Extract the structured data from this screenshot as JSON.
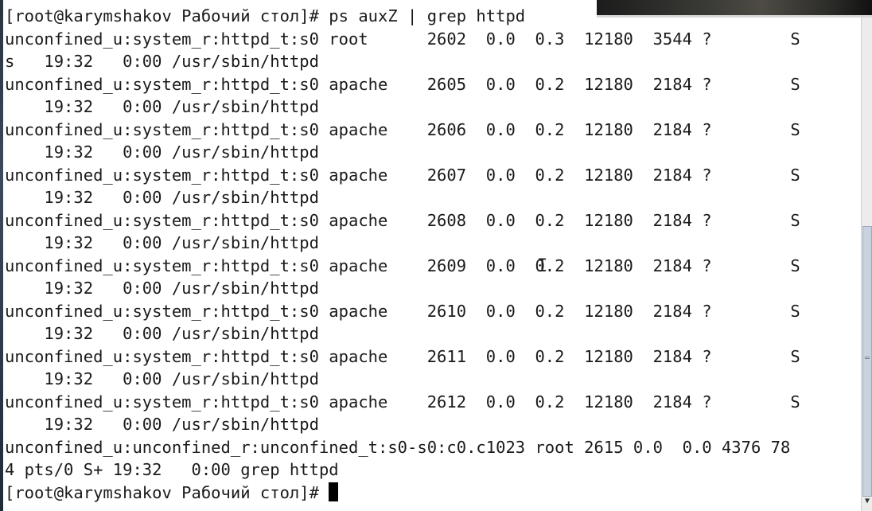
{
  "terminal": {
    "lines": [
      "[root@karymshakov Рабочий стол]# ps auxZ | grep httpd",
      "unconfined_u:system_r:httpd_t:s0 root      2602  0.0  0.3  12180  3544 ?        S",
      "s   19:32   0:00 /usr/sbin/httpd",
      "unconfined_u:system_r:httpd_t:s0 apache    2605  0.0  0.2  12180  2184 ?        S",
      "    19:32   0:00 /usr/sbin/httpd",
      "unconfined_u:system_r:httpd_t:s0 apache    2606  0.0  0.2  12180  2184 ?        S",
      "    19:32   0:00 /usr/sbin/httpd",
      "unconfined_u:system_r:httpd_t:s0 apache    2607  0.0  0.2  12180  2184 ?        S",
      "    19:32   0:00 /usr/sbin/httpd",
      "unconfined_u:system_r:httpd_t:s0 apache    2608  0.0  0.2  12180  2184 ?        S",
      "    19:32   0:00 /usr/sbin/httpd",
      "unconfined_u:system_r:httpd_t:s0 apache    2609  0.0  0.2  12180  2184 ?        S",
      "    19:32   0:00 /usr/sbin/httpd",
      "unconfined_u:system_r:httpd_t:s0 apache    2610  0.0  0.2  12180  2184 ?        S",
      "    19:32   0:00 /usr/sbin/httpd",
      "unconfined_u:system_r:httpd_t:s0 apache    2611  0.0  0.2  12180  2184 ?        S",
      "    19:32   0:00 /usr/sbin/httpd",
      "unconfined_u:system_r:httpd_t:s0 apache    2612  0.0  0.2  12180  2184 ?        S",
      "    19:32   0:00 /usr/sbin/httpd",
      "unconfined_u:unconfined_r:unconfined_t:s0-s0:c0.c1023 root 2615 0.0  0.0 4376 78",
      "4 pts/0 S+ 19:32   0:00 grep httpd"
    ],
    "prompt": "[root@karymshakov Рабочий стол]# "
  },
  "icons": {
    "cursor": "block-cursor",
    "mouse_pointer": "text-ibeam-icon",
    "scrollbar_grip": "grip-icon",
    "scroll_down": "arrow-down-icon"
  },
  "colors": {
    "background": "#ffffff",
    "text": "#1a1a1a",
    "scroll_thumb": "#c9d3df"
  }
}
